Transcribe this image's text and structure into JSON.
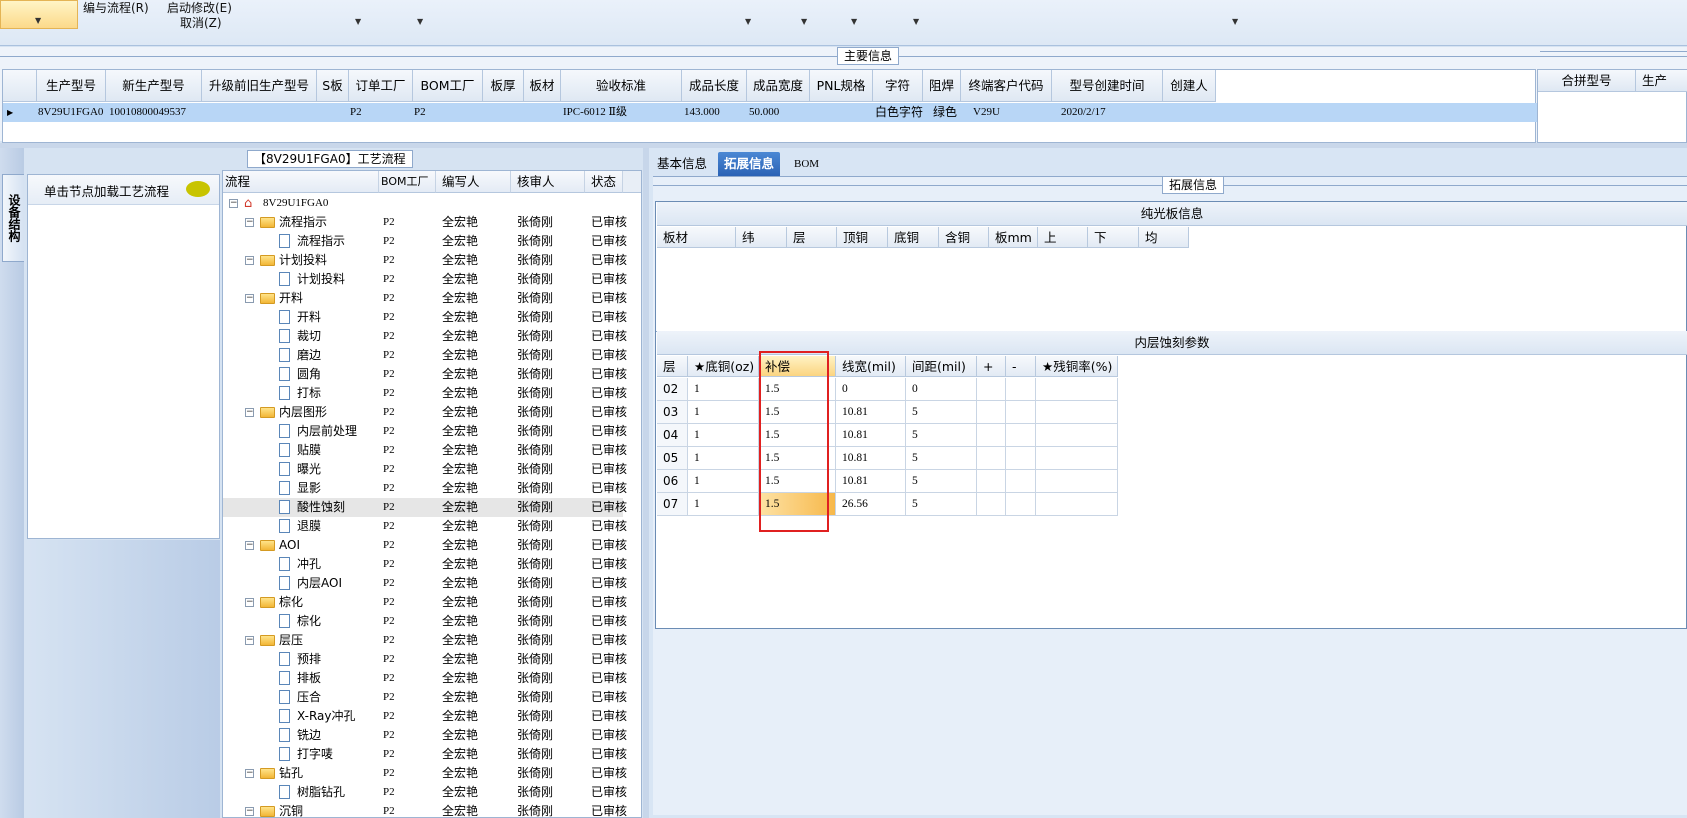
{
  "toolbar": {
    "items": [
      "编与流程(R)",
      "启动修改(E)",
      "取消(Z)"
    ]
  },
  "main_info": {
    "legend": "主要信息",
    "columns": [
      "生产型号",
      "新生产型号",
      "升级前旧生产型号",
      "S板",
      "订单工厂",
      "BOM工厂",
      "板厚",
      "板材",
      "验收标准",
      "成品长度",
      "成品宽度",
      "PNL规格",
      "字符",
      "阻焊",
      "终端客户代码",
      "型号创建时间",
      "创建人"
    ],
    "row": [
      "8V29U1FGA0",
      "10010800049537",
      "",
      "",
      "P2",
      "P2",
      "",
      "",
      "IPC-6012 Ⅱ级",
      "143.000",
      "50.000",
      "",
      "白色字符",
      "绿色",
      "V29U",
      "2020/2/17",
      ""
    ],
    "right_columns": [
      "合拼型号",
      "生产"
    ]
  },
  "left_panel": {
    "vertical_tab": "设备结构",
    "hint": "单击节点加载工艺流程"
  },
  "tree": {
    "legend": "【8V29U1FGA0】工艺流程",
    "columns": [
      "流程",
      "BOM工厂",
      "编写人",
      "核审人",
      "状态"
    ],
    "root": "8V29U1FGA0",
    "rows": [
      {
        "name": "流程指示",
        "type": "folder",
        "bom": "P2",
        "author": "全宏艳",
        "reviewer": "张倚刚",
        "status": "已审核"
      },
      {
        "name": "流程指示",
        "type": "doc",
        "bom": "P2",
        "author": "全宏艳",
        "reviewer": "张倚刚",
        "status": "已审核"
      },
      {
        "name": "计划投料",
        "type": "folder",
        "bom": "P2",
        "author": "全宏艳",
        "reviewer": "张倚刚",
        "status": "已审核"
      },
      {
        "name": "计划投料",
        "type": "doc",
        "bom": "P2",
        "author": "全宏艳",
        "reviewer": "张倚刚",
        "status": "已审核"
      },
      {
        "name": "开料",
        "type": "folder",
        "bom": "P2",
        "author": "全宏艳",
        "reviewer": "张倚刚",
        "status": "已审核"
      },
      {
        "name": "开料",
        "type": "doc",
        "bom": "P2",
        "author": "全宏艳",
        "reviewer": "张倚刚",
        "status": "已审核"
      },
      {
        "name": "裁切",
        "type": "doc",
        "bom": "P2",
        "author": "全宏艳",
        "reviewer": "张倚刚",
        "status": "已审核"
      },
      {
        "name": "磨边",
        "type": "doc",
        "bom": "P2",
        "author": "全宏艳",
        "reviewer": "张倚刚",
        "status": "已审核"
      },
      {
        "name": "圆角",
        "type": "doc",
        "bom": "P2",
        "author": "全宏艳",
        "reviewer": "张倚刚",
        "status": "已审核"
      },
      {
        "name": "打标",
        "type": "doc",
        "bom": "P2",
        "author": "全宏艳",
        "reviewer": "张倚刚",
        "status": "已审核"
      },
      {
        "name": "内层图形",
        "type": "folder",
        "bom": "P2",
        "author": "全宏艳",
        "reviewer": "张倚刚",
        "status": "已审核"
      },
      {
        "name": "内层前处理",
        "type": "doc",
        "bom": "P2",
        "author": "全宏艳",
        "reviewer": "张倚刚",
        "status": "已审核"
      },
      {
        "name": "贴膜",
        "type": "doc",
        "bom": "P2",
        "author": "全宏艳",
        "reviewer": "张倚刚",
        "status": "已审核"
      },
      {
        "name": "曝光",
        "type": "doc",
        "bom": "P2",
        "author": "全宏艳",
        "reviewer": "张倚刚",
        "status": "已审核"
      },
      {
        "name": "显影",
        "type": "doc",
        "bom": "P2",
        "author": "全宏艳",
        "reviewer": "张倚刚",
        "status": "已审核"
      },
      {
        "name": "酸性蚀刻",
        "type": "doc",
        "bom": "P2",
        "author": "全宏艳",
        "reviewer": "张倚刚",
        "status": "已审核"
      },
      {
        "name": "退膜",
        "type": "doc",
        "bom": "P2",
        "author": "全宏艳",
        "reviewer": "张倚刚",
        "status": "已审核"
      },
      {
        "name": "AOI",
        "type": "folder",
        "bom": "P2",
        "author": "全宏艳",
        "reviewer": "张倚刚",
        "status": "已审核"
      },
      {
        "name": "冲孔",
        "type": "doc",
        "bom": "P2",
        "author": "全宏艳",
        "reviewer": "张倚刚",
        "status": "已审核"
      },
      {
        "name": "内层AOI",
        "type": "doc",
        "bom": "P2",
        "author": "全宏艳",
        "reviewer": "张倚刚",
        "status": "已审核"
      },
      {
        "name": "棕化",
        "type": "folder",
        "bom": "P2",
        "author": "全宏艳",
        "reviewer": "张倚刚",
        "status": "已审核"
      },
      {
        "name": "棕化",
        "type": "doc",
        "bom": "P2",
        "author": "全宏艳",
        "reviewer": "张倚刚",
        "status": "已审核"
      },
      {
        "name": "层压",
        "type": "folder",
        "bom": "P2",
        "author": "全宏艳",
        "reviewer": "张倚刚",
        "status": "已审核"
      },
      {
        "name": "预排",
        "type": "doc",
        "bom": "P2",
        "author": "全宏艳",
        "reviewer": "张倚刚",
        "status": "已审核"
      },
      {
        "name": "排板",
        "type": "doc",
        "bom": "P2",
        "author": "全宏艳",
        "reviewer": "张倚刚",
        "status": "已审核"
      },
      {
        "name": "压合",
        "type": "doc",
        "bom": "P2",
        "author": "全宏艳",
        "reviewer": "张倚刚",
        "status": "已审核"
      },
      {
        "name": "X-Ray冲孔",
        "type": "doc",
        "bom": "P2",
        "author": "全宏艳",
        "reviewer": "张倚刚",
        "status": "已审核"
      },
      {
        "name": "铣边",
        "type": "doc",
        "bom": "P2",
        "author": "全宏艳",
        "reviewer": "张倚刚",
        "status": "已审核"
      },
      {
        "name": "打字唛",
        "type": "doc",
        "bom": "P2",
        "author": "全宏艳",
        "reviewer": "张倚刚",
        "status": "已审核"
      },
      {
        "name": "钻孔",
        "type": "folder",
        "bom": "P2",
        "author": "全宏艳",
        "reviewer": "张倚刚",
        "status": "已审核"
      },
      {
        "name": "树脂钻孔",
        "type": "doc",
        "bom": "P2",
        "author": "全宏艳",
        "reviewer": "张倚刚",
        "status": "已审核"
      },
      {
        "name": "沉铜",
        "type": "folder",
        "bom": "P2",
        "author": "全宏艳",
        "reviewer": "张倚刚",
        "status": "已审核"
      }
    ]
  },
  "tabs": [
    "基本信息",
    "拓展信息",
    "BOM"
  ],
  "ext": {
    "legend": "拓展信息",
    "board_title": "纯光板信息",
    "board_columns": [
      "板材",
      "纬",
      "层",
      "顶铜",
      "底铜",
      "含铜",
      "板mm",
      "上",
      "下",
      "均"
    ],
    "etch_title": "内层蚀刻参数",
    "etch_columns": [
      "层",
      "★底铜(oz)",
      "补偿",
      "线宽(mil)",
      "间距(mil)",
      "+",
      "-",
      "★残铜率(%)"
    ],
    "etch_rows": [
      [
        "02",
        "1",
        "1.5",
        "0",
        "0",
        "",
        "",
        ""
      ],
      [
        "03",
        "1",
        "1.5",
        "10.81",
        "5",
        "",
        "",
        ""
      ],
      [
        "04",
        "1",
        "1.5",
        "10.81",
        "5",
        "",
        "",
        ""
      ],
      [
        "05",
        "1",
        "1.5",
        "10.81",
        "5",
        "",
        "",
        ""
      ],
      [
        "06",
        "1",
        "1.5",
        "10.81",
        "5",
        "",
        "",
        ""
      ],
      [
        "07",
        "1",
        "1.5",
        "26.56",
        "5",
        "",
        "",
        ""
      ]
    ]
  }
}
